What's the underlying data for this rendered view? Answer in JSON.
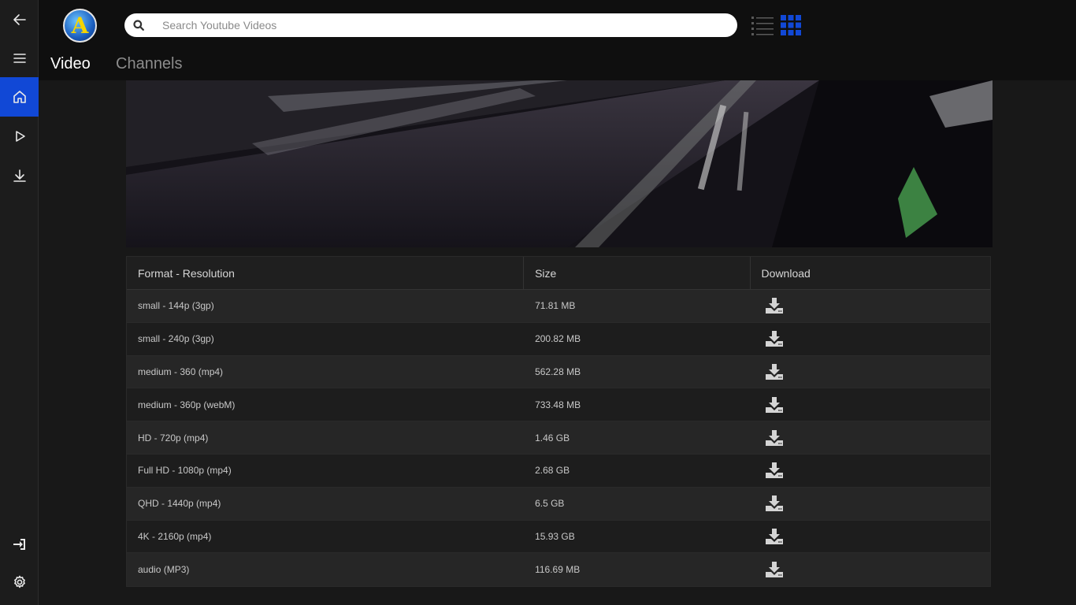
{
  "header": {
    "search_placeholder": "Search Youtube Videos",
    "logo_letter": "A",
    "tabs": [
      {
        "label": "Video"
      },
      {
        "label": "Channels"
      }
    ]
  },
  "colors": {
    "accent": "#1148d6",
    "background": "#181818",
    "header": "#0f0f0f"
  },
  "sidebar": {
    "icons": [
      "back-arrow-icon",
      "menu-icon",
      "home-icon",
      "play-icon",
      "download-icon",
      "login-icon",
      "gear-icon"
    ],
    "active": "home-icon"
  },
  "table": {
    "headers": [
      "Format - Resolution",
      "Size",
      "Download"
    ],
    "rows": [
      {
        "format": "small - 144p (3gp)",
        "size": "71.81 MB"
      },
      {
        "format": "small - 240p (3gp)",
        "size": "200.82 MB"
      },
      {
        "format": "medium - 360 (mp4)",
        "size": "562.28 MB"
      },
      {
        "format": "medium - 360p (webM)",
        "size": "733.48 MB"
      },
      {
        "format": "HD - 720p (mp4)",
        "size": "1.46 GB"
      },
      {
        "format": "Full HD - 1080p (mp4)",
        "size": "2.68 GB"
      },
      {
        "format": "QHD - 1440p (mp4)",
        "size": "6.5 GB"
      },
      {
        "format": "4K - 2160p (mp4)",
        "size": "15.93 GB"
      },
      {
        "format": "audio (MP3)",
        "size": "116.69 MB"
      }
    ]
  }
}
